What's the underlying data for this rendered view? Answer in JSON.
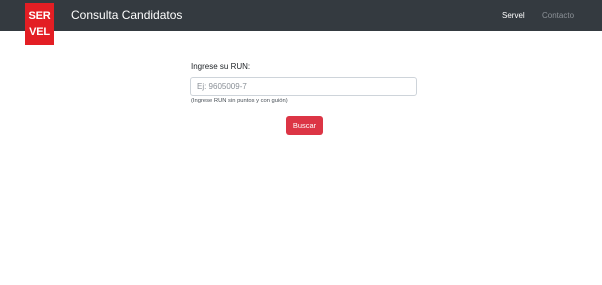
{
  "logo": {
    "line1": "SER",
    "line2": "VEL"
  },
  "navbar": {
    "title": "Consulta Candidatos",
    "links": [
      {
        "label": "Servel",
        "active": true
      },
      {
        "label": "Contacto",
        "active": false
      }
    ]
  },
  "form": {
    "label": "Ingrese su RUN:",
    "input": {
      "value": "",
      "placeholder": "Ej: 9605009-7"
    },
    "helper": "(Ingrese RUN sin puntos y con guión)",
    "submit_label": "Buscar"
  },
  "colors": {
    "navbar": "#343a40",
    "logo": "#e31e24",
    "button": "#dc3545"
  }
}
